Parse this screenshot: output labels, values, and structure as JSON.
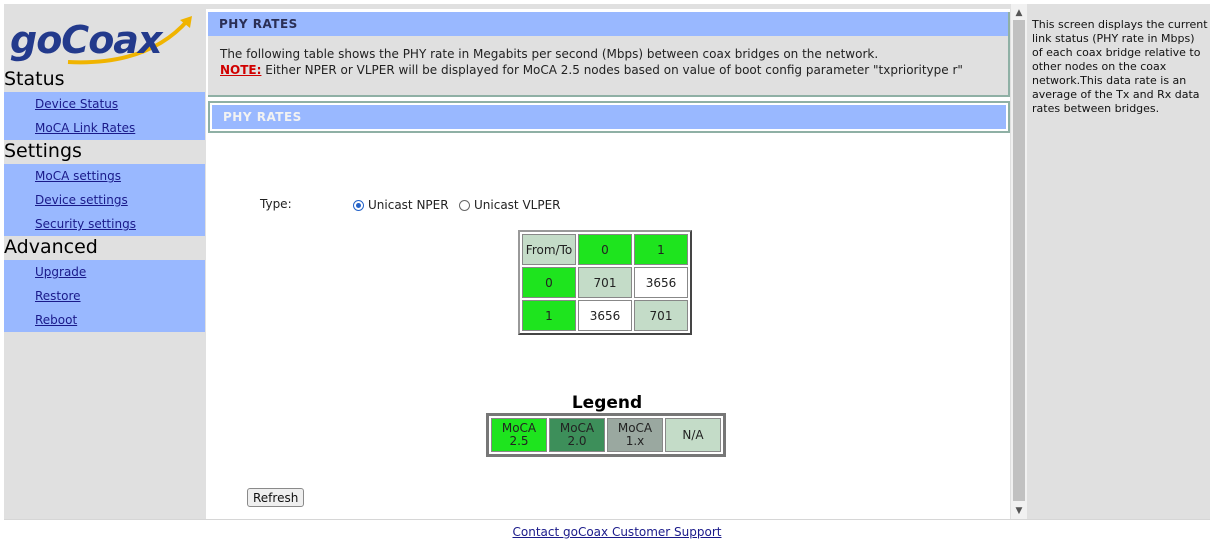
{
  "brand": {
    "logo_text": "goCoax",
    "logo_color": "#233a8c",
    "swoosh_color": "#f0b400"
  },
  "nav": {
    "status": {
      "heading": "Status",
      "items": [
        {
          "label": "Device Status"
        },
        {
          "label": "MoCA Link Rates"
        }
      ]
    },
    "settings": {
      "heading": "Settings",
      "items": [
        {
          "label": "MoCA settings"
        },
        {
          "label": "Device settings"
        },
        {
          "label": "Security settings"
        }
      ]
    },
    "advanced": {
      "heading": "Advanced",
      "items": [
        {
          "label": "Upgrade"
        },
        {
          "label": "Restore"
        },
        {
          "label": "Reboot"
        }
      ]
    }
  },
  "main": {
    "header": "PHY RATES",
    "description": "The following table shows the PHY rate in Megabits per second (Mbps) between coax bridges on the network.",
    "note_label": "NOTE:",
    "note_text": " Either NPER or VLPER will be displayed for MoCA 2.5 nodes based on value of boot config parameter \"txprioritype r\"",
    "sub_header": "PHY RATES",
    "type_label": "Type:",
    "radio_options": [
      {
        "label": "Unicast NPER",
        "selected": true
      },
      {
        "label": "Unicast VLPER",
        "selected": false
      }
    ],
    "table": {
      "corner": "From/To",
      "columns": [
        "0",
        "1"
      ],
      "rows": [
        {
          "node": "0",
          "cells": [
            "701",
            "3656"
          ]
        },
        {
          "node": "1",
          "cells": [
            "3656",
            "701"
          ]
        }
      ]
    },
    "legend": {
      "title": "Legend",
      "items": [
        {
          "line1": "MoCA",
          "line2": "2.5",
          "color": "#1ee41e"
        },
        {
          "line1": "MoCA",
          "line2": "2.0",
          "color": "#3d8f5a"
        },
        {
          "line1": "MoCA",
          "line2": "1.x",
          "color": "#9aa8a0"
        },
        {
          "line1": "N/A",
          "line2": "",
          "color": "#c4dcc8"
        }
      ]
    },
    "refresh_label": "Refresh"
  },
  "help": {
    "text": "This screen displays the current link status (PHY rate in Mbps) of each coax bridge relative to other nodes on the coax network.This data rate is an average of the Tx and Rx data rates between bridges."
  },
  "footer": {
    "support_link": "Contact goCoax Customer Support"
  },
  "colors": {
    "header_bar": "#99b8ff",
    "nav_bg": "#99b8ff",
    "page_bg": "#e0e0e0",
    "link": "#1a1a8a",
    "note_red": "#d00000"
  }
}
